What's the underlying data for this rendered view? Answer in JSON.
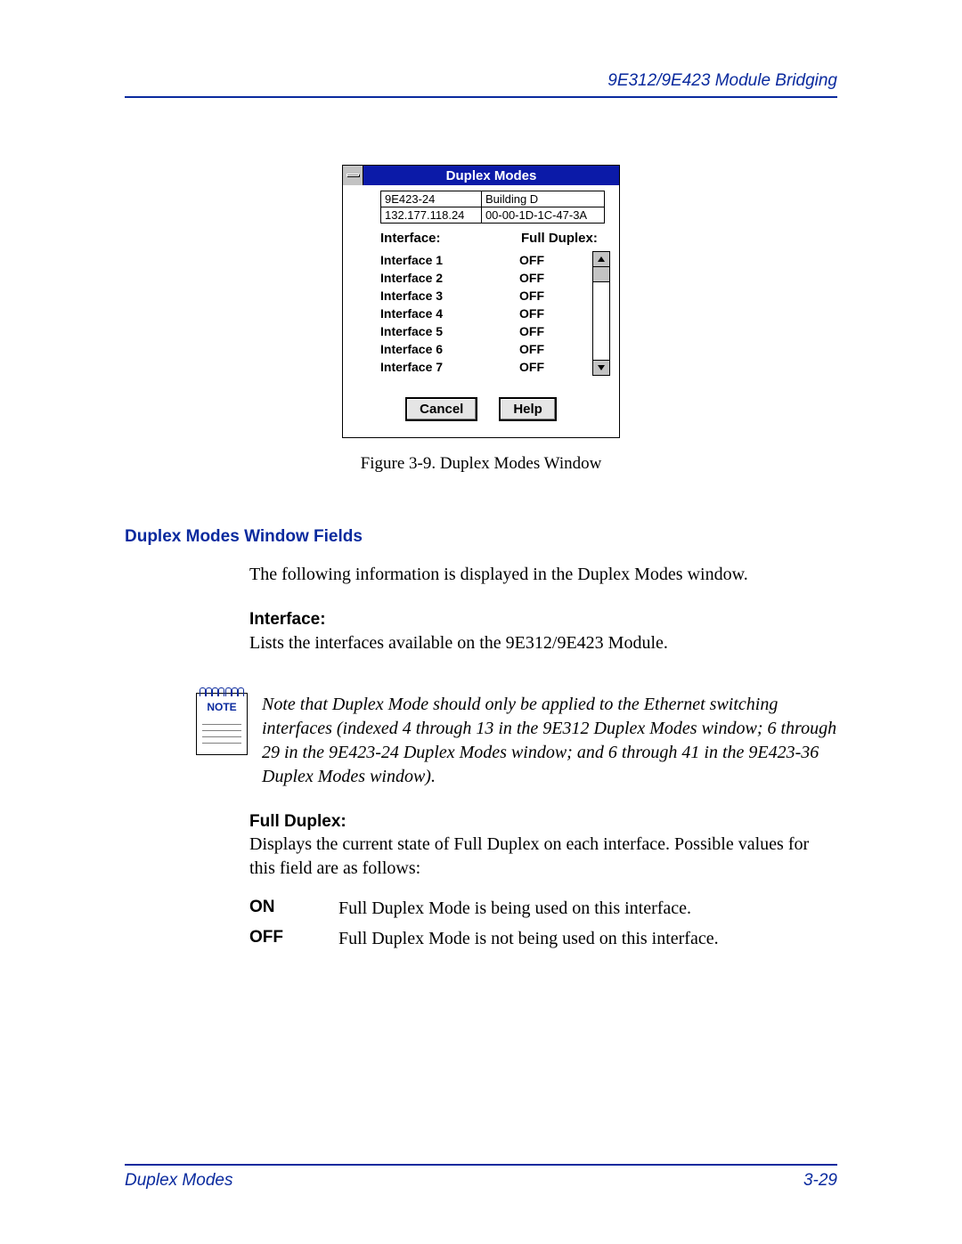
{
  "header": {
    "section_title": "9E312/9E423 Module Bridging"
  },
  "dialog": {
    "title": "Duplex Modes",
    "device_model": "9E423-24",
    "device_name": "Building D",
    "ip_address": "132.177.118.24",
    "mac_address": "00-00-1D-1C-47-3A",
    "col_interface": "Interface:",
    "col_fullduplex": "Full Duplex:",
    "rows": [
      {
        "iface": "Interface 1",
        "state": "OFF"
      },
      {
        "iface": "Interface 2",
        "state": "OFF"
      },
      {
        "iface": "Interface 3",
        "state": "OFF"
      },
      {
        "iface": "Interface 4",
        "state": "OFF"
      },
      {
        "iface": "Interface 5",
        "state": "OFF"
      },
      {
        "iface": "Interface 6",
        "state": "OFF"
      },
      {
        "iface": "Interface 7",
        "state": "OFF"
      }
    ],
    "cancel_label": "Cancel",
    "help_label": "Help"
  },
  "figure_caption": "Figure 3-9. Duplex Modes Window",
  "section_heading": "Duplex Modes Window Fields",
  "intro_text": "The following information is displayed in the Duplex Modes window.",
  "field_interface": {
    "title": "Interface:",
    "text": "Lists the interfaces available on the 9E312/9E423 Module."
  },
  "note": {
    "badge": "NOTE",
    "text": "Note that Duplex Mode should only be applied to the Ethernet switching interfaces (indexed 4 through 13 in the 9E312 Duplex Modes window; 6 through 29 in the 9E423-24 Duplex Modes window; and 6 through 41 in the 9E423-36 Duplex Modes window)."
  },
  "field_fullduplex": {
    "title": "Full Duplex:",
    "text": "Displays the current state of Full Duplex on each interface. Possible values for this field are as follows:",
    "values": [
      {
        "key": "ON",
        "desc": "Full Duplex Mode is being used on this interface."
      },
      {
        "key": "OFF",
        "desc": "Full Duplex Mode is not being used on this interface."
      }
    ]
  },
  "footer": {
    "left": "Duplex Modes",
    "right": "3-29"
  }
}
